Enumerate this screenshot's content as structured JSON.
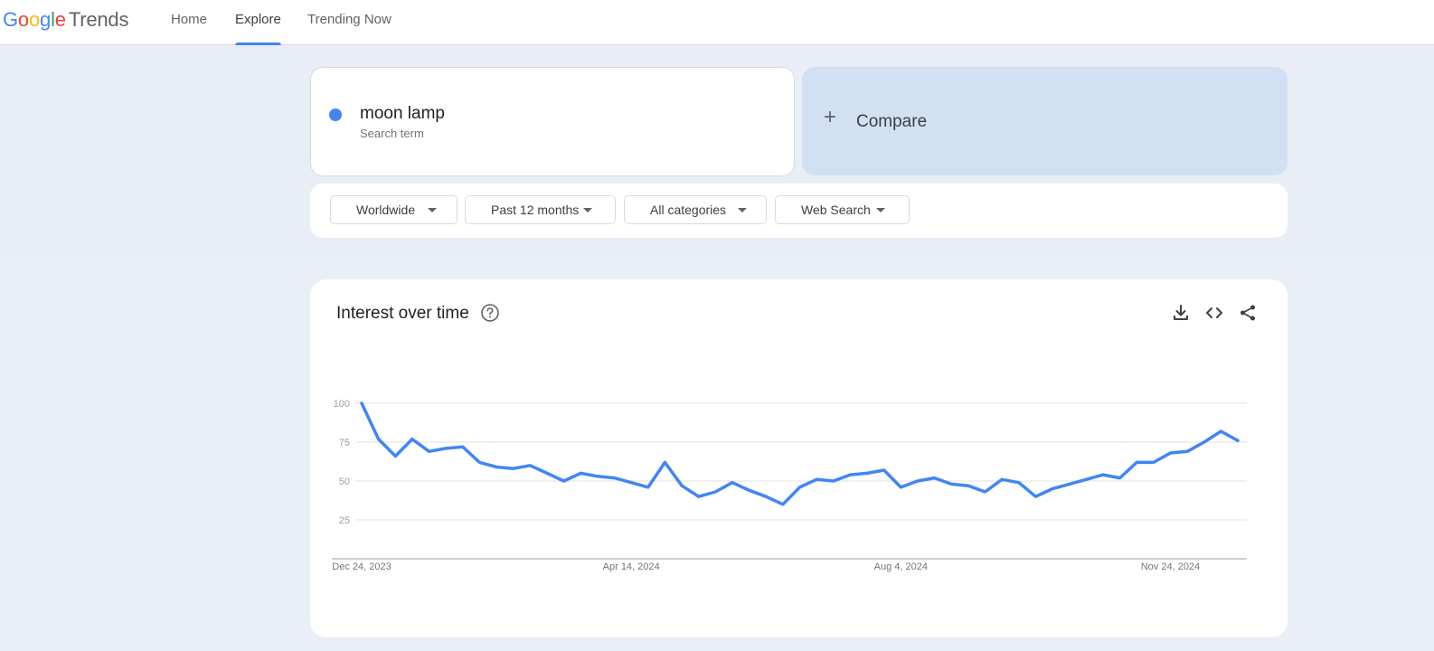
{
  "header": {
    "logo": {
      "g": "G",
      "o1": "o",
      "o2": "o",
      "g2": "g",
      "l": "l",
      "e": "e",
      "product": "Trends"
    },
    "nav": [
      {
        "label": "Home"
      },
      {
        "label": "Explore",
        "active": true
      },
      {
        "label": "Trending Now"
      }
    ]
  },
  "search": {
    "term": "moon lamp",
    "term_type": "Search term",
    "term_color": "#4285f4",
    "compare_label": "Compare"
  },
  "filters": [
    {
      "label": "Worldwide"
    },
    {
      "label": "Past 12 months"
    },
    {
      "label": "All categories"
    },
    {
      "label": "Web Search"
    }
  ],
  "chart_card": {
    "title": "Interest over time",
    "icons": [
      "help-icon",
      "download-icon",
      "embed-code-icon",
      "share-icon"
    ]
  },
  "chart_data": {
    "type": "line",
    "title": "Interest over time",
    "xlabel": "",
    "ylabel": "",
    "ylim": [
      0,
      100
    ],
    "yticks": [
      25,
      50,
      75,
      100
    ],
    "xtick_labels": [
      "Dec 24, 2023",
      "Apr 14, 2024",
      "Aug 4, 2024",
      "Nov 24, 2024"
    ],
    "xtick_index": [
      0,
      16,
      32,
      48
    ],
    "grid": true,
    "color": "#4285f4",
    "x": [
      "Dec 24, 2023",
      "Dec 31, 2023",
      "Jan 7, 2024",
      "Jan 14, 2024",
      "Jan 21, 2024",
      "Jan 28, 2024",
      "Feb 4, 2024",
      "Feb 11, 2024",
      "Feb 18, 2024",
      "Feb 25, 2024",
      "Mar 3, 2024",
      "Mar 10, 2024",
      "Mar 17, 2024",
      "Mar 24, 2024",
      "Mar 31, 2024",
      "Apr 7, 2024",
      "Apr 14, 2024",
      "Apr 21, 2024",
      "Apr 28, 2024",
      "May 5, 2024",
      "May 12, 2024",
      "May 19, 2024",
      "May 26, 2024",
      "Jun 2, 2024",
      "Jun 9, 2024",
      "Jun 16, 2024",
      "Jun 23, 2024",
      "Jun 30, 2024",
      "Jul 7, 2024",
      "Jul 14, 2024",
      "Jul 21, 2024",
      "Jul 28, 2024",
      "Aug 4, 2024",
      "Aug 11, 2024",
      "Aug 18, 2024",
      "Aug 25, 2024",
      "Sep 1, 2024",
      "Sep 8, 2024",
      "Sep 15, 2024",
      "Sep 22, 2024",
      "Sep 29, 2024",
      "Oct 6, 2024",
      "Oct 13, 2024",
      "Oct 20, 2024",
      "Oct 27, 2024",
      "Nov 3, 2024",
      "Nov 10, 2024",
      "Nov 17, 2024",
      "Nov 24, 2024",
      "Dec 1, 2024",
      "Dec 8, 2024",
      "Dec 15, 2024",
      "Dec 22, 2024",
      "Dec 29, 2024"
    ],
    "values": [
      100,
      77,
      66,
      77,
      69,
      71,
      72,
      62,
      59,
      58,
      60,
      55,
      50,
      55,
      53,
      52,
      49,
      46,
      62,
      47,
      40,
      43,
      49,
      44,
      40,
      35,
      46,
      51,
      50,
      54,
      55,
      57,
      46,
      50,
      52,
      48,
      47,
      43,
      51,
      49,
      40,
      45,
      48,
      51,
      54,
      52,
      62,
      62,
      68,
      69,
      75,
      82,
      76
    ]
  }
}
